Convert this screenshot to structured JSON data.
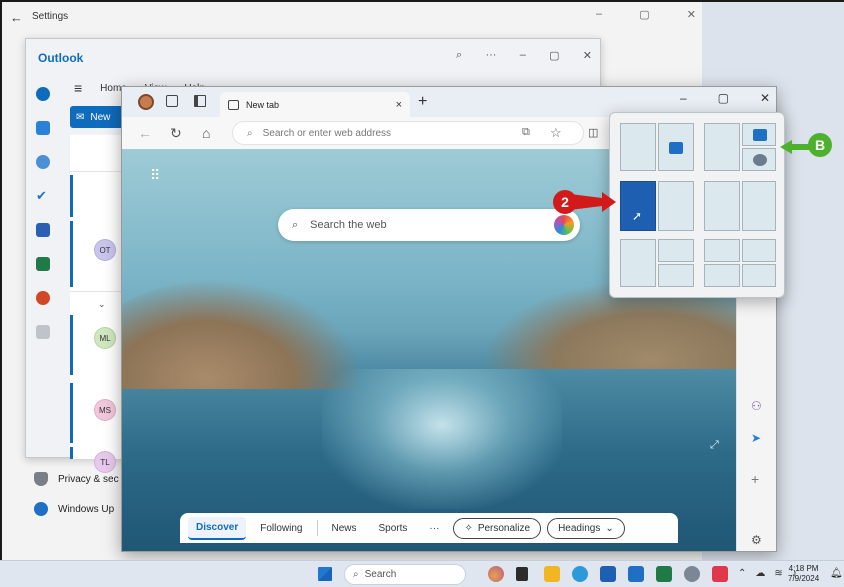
{
  "settings": {
    "back_glyph": "←",
    "title": "Settings",
    "controls": [
      "–",
      "▢",
      "✕"
    ],
    "nav": [
      {
        "label": "Privacy & sec",
        "icon": "shield-icon"
      },
      {
        "label": "Windows Up",
        "icon": "windows-update-icon"
      }
    ]
  },
  "outlook": {
    "brand": "Outlook",
    "title_controls": [
      "⌕",
      "···",
      "–",
      "▢",
      "✕"
    ],
    "menu_tabs": [
      "Home",
      "View",
      "Help"
    ],
    "new_button_label": "New",
    "chevron": "⌄",
    "avatars": [
      {
        "initials": "OT",
        "color": "#c9c6ee"
      },
      {
        "initials": "ML",
        "color": "#cfe8c0"
      },
      {
        "initials": "MS",
        "color": "#f2c7dd"
      },
      {
        "initials": "TL",
        "color": "#e7c9ee"
      }
    ],
    "rail_icons": [
      "mail-icon",
      "calendar-icon",
      "people-icon",
      "todo-icon",
      "word-icon",
      "excel-icon",
      "powerpoint-icon",
      "apps-grid-icon"
    ]
  },
  "edge": {
    "tab_title": "New tab",
    "tab_close": "×",
    "new_tab_glyph": "+",
    "controls": [
      "–",
      "▢",
      "✕"
    ],
    "address_placeholder": "Search or enter web address",
    "page_search_placeholder": "Search the web",
    "feed_tabs": {
      "active": "Discover",
      "others": [
        "Following",
        "News",
        "Sports"
      ],
      "more": "···",
      "personalize": "Personalize",
      "headings": "Headings"
    }
  },
  "callouts": {
    "step": "2",
    "letter": "B"
  },
  "taskbar": {
    "search_placeholder": "Search",
    "time": "4:18 PM",
    "date": "7/9/2024"
  },
  "colors": {
    "accent": "#0f6cbd",
    "snap_selected": "#1f5fb2",
    "callout_red": "#d21a1a",
    "callout_green": "#4db12e"
  }
}
